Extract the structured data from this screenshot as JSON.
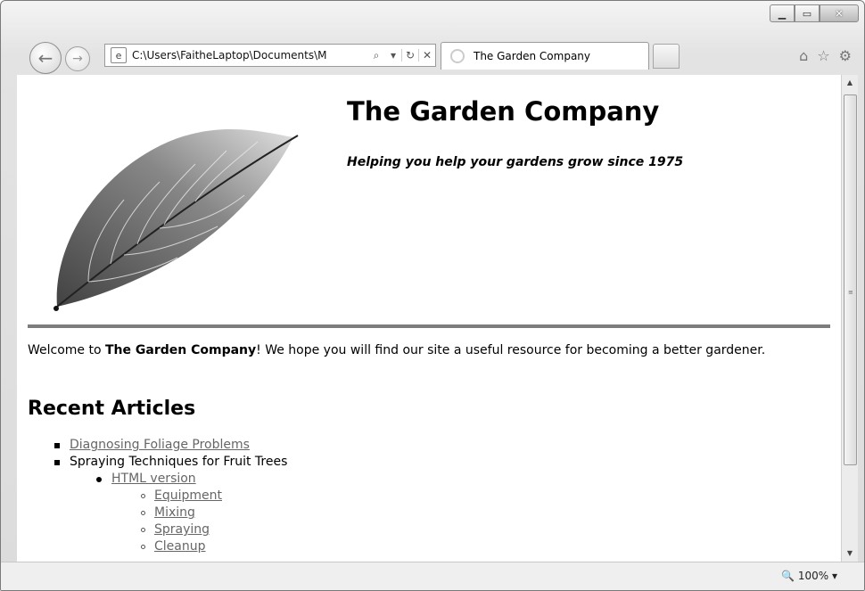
{
  "browser": {
    "address_url": "C:\\Users\\FaitheLaptop\\Documents\\M",
    "tab_title": "The Garden Company",
    "zoom": "100%"
  },
  "page": {
    "title": "The Garden Company",
    "tagline": "Helping you help your gardens grow since 1975",
    "welcome_prefix": "Welcome to ",
    "welcome_bold": "The Garden Company",
    "welcome_suffix": "! We hope you will find our site a useful resource for becoming a better gardener.",
    "recent_heading": "Recent Articles",
    "articles": {
      "a1": "Diagnosing Foliage Problems",
      "a2": "Spraying Techniques for Fruit Trees",
      "a2_sub": "HTML version",
      "a2_items": [
        "Equipment",
        "Mixing",
        "Spraying",
        "Cleanup"
      ]
    }
  },
  "icons": {
    "back": "back-arrow-icon",
    "forward": "forward-arrow-icon",
    "home": "home-icon",
    "favorites": "star-icon",
    "tools": "gear-icon"
  }
}
